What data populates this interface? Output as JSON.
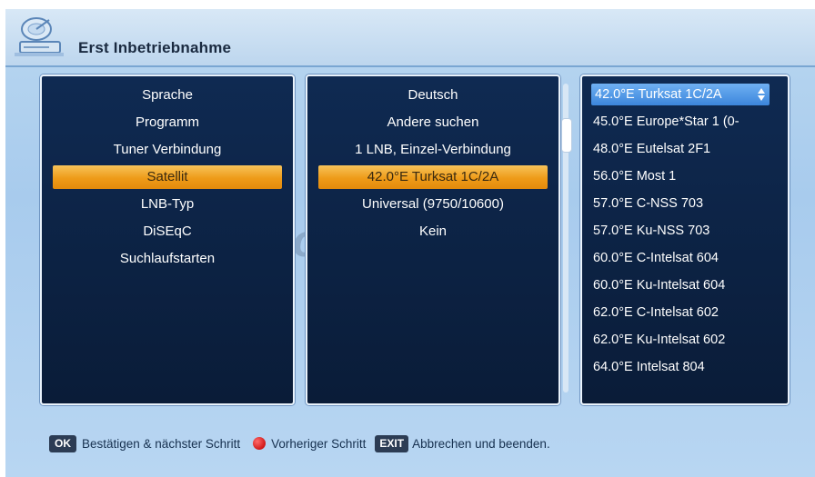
{
  "header": {
    "title": "Erst Inbetriebnahme",
    "icon": "satellite-dish-icon"
  },
  "menu": {
    "items": [
      "Sprache",
      "Programm",
      "Tuner Verbindung",
      "Satellit",
      "LNB-Typ",
      "DiSEqC",
      "Suchlaufstarten"
    ],
    "selected_index": 3
  },
  "values": {
    "items": [
      "Deutsch",
      "Andere suchen",
      "1 LNB, Einzel-Verbindung",
      "42.0°E Turksat 1C/2A",
      "Universal (9750/10600)",
      "Kein"
    ],
    "selected_index": 3
  },
  "satellite_list": {
    "items": [
      "42.0°E Turksat 1C/2A",
      "45.0°E Europe*Star 1 (0-",
      "48.0°E Eutelsat 2F1",
      "56.0°E Most 1",
      "57.0°E C-NSS 703",
      "57.0°E Ku-NSS 703",
      "60.0°E C-Intelsat 604",
      "60.0°E Ku-Intelsat 604",
      "62.0°E C-Intelsat 602",
      "62.0°E Ku-Intelsat 602",
      "64.0°E Intelsat 804"
    ],
    "highlighted_index": 0
  },
  "watermark": "homecast",
  "footer": {
    "ok_key": "OK",
    "ok_label": "Bestätigen & nächster Schritt",
    "red_label": "Vorheriger Schritt",
    "exit_key": "EXIT",
    "exit_label": "Abbrechen und beenden."
  },
  "colors": {
    "panel_bg": "#0f2a52",
    "selection_orange": "#ee9b18",
    "list_highlight_blue": "#3c86dc",
    "screen_bg": "#b9d7f0"
  }
}
